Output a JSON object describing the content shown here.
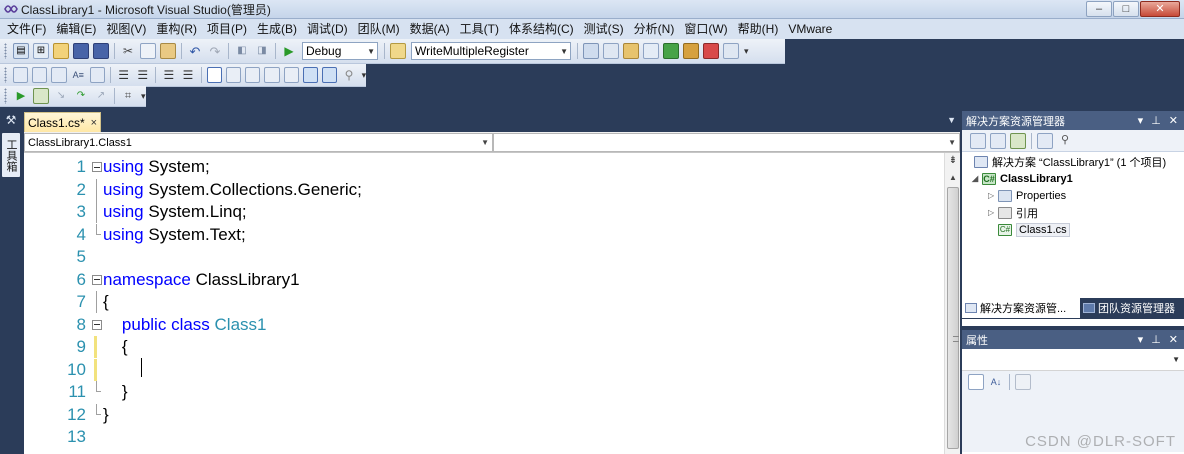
{
  "window": {
    "title": "ClassLibrary1 - Microsoft Visual Studio(管理员)",
    "controls": [
      "–",
      "□",
      "✕"
    ]
  },
  "menu": [
    "文件(F)",
    "编辑(E)",
    "视图(V)",
    "重构(R)",
    "项目(P)",
    "生成(B)",
    "调试(D)",
    "团队(M)",
    "数据(A)",
    "工具(T)",
    "体系结构(C)",
    "测试(S)",
    "分析(N)",
    "窗口(W)",
    "帮助(H)",
    "VMware"
  ],
  "toolbar": {
    "config": "Debug",
    "find_text": "WriteMultipleRegister"
  },
  "toolbox": {
    "label": "工具箱"
  },
  "editor": {
    "tab": {
      "label": "Class1.cs*",
      "close": "×"
    },
    "nav": {
      "class_combo": "ClassLibrary1.Class1",
      "member_combo": ""
    },
    "lines": [
      {
        "n": "1",
        "code": [
          [
            "kw",
            "using"
          ],
          [
            "t",
            " System;"
          ]
        ]
      },
      {
        "n": "2",
        "code": [
          [
            "kw",
            "using"
          ],
          [
            "t",
            " System.Collections.Generic;"
          ]
        ]
      },
      {
        "n": "3",
        "code": [
          [
            "kw",
            "using"
          ],
          [
            "t",
            " System.Linq;"
          ]
        ]
      },
      {
        "n": "4",
        "code": [
          [
            "kw",
            "using"
          ],
          [
            "t",
            " System.Text;"
          ]
        ]
      },
      {
        "n": "5",
        "code": []
      },
      {
        "n": "6",
        "code": [
          [
            "kw",
            "namespace"
          ],
          [
            "t",
            " ClassLibrary1"
          ]
        ]
      },
      {
        "n": "7",
        "code": [
          [
            "t",
            "{"
          ]
        ]
      },
      {
        "n": "8",
        "code": [
          [
            "t",
            "    "
          ],
          [
            "kw",
            "public"
          ],
          [
            "t",
            " "
          ],
          [
            "kw",
            "class"
          ],
          [
            "t",
            " "
          ],
          [
            "ty",
            "Class1"
          ]
        ]
      },
      {
        "n": "9",
        "code": [
          [
            "t",
            "    {"
          ]
        ]
      },
      {
        "n": "10",
        "code": [
          [
            "t",
            "        "
          ],
          [
            "caret",
            ""
          ]
        ]
      },
      {
        "n": "11",
        "code": [
          [
            "t",
            "    }"
          ]
        ]
      },
      {
        "n": "12",
        "code": [
          [
            "t",
            "}"
          ]
        ]
      },
      {
        "n": "13",
        "code": []
      }
    ]
  },
  "solution_explorer": {
    "title": "解决方案资源管理器",
    "nodes": [
      {
        "label": "解决方案 “ClassLibrary1” (1 个项目)",
        "bold": false
      },
      {
        "label": "ClassLibrary1",
        "bold": true
      },
      {
        "label": "Properties",
        "bold": false
      },
      {
        "label": "引用",
        "bold": false
      },
      {
        "label": "Class1.cs",
        "bold": false
      }
    ],
    "tabs": [
      "解决方案资源管...",
      "团队资源管理器"
    ]
  },
  "properties": {
    "title": "属性"
  },
  "watermark": "CSDN @DLR-SOFT",
  "colors": {
    "keyword": "#0000ff",
    "type": "#2b91af",
    "line_number": "#2b91af",
    "chrome": "#2b3c59",
    "panel_title": "#4a5f83",
    "changed_line": "#f2e27d"
  }
}
